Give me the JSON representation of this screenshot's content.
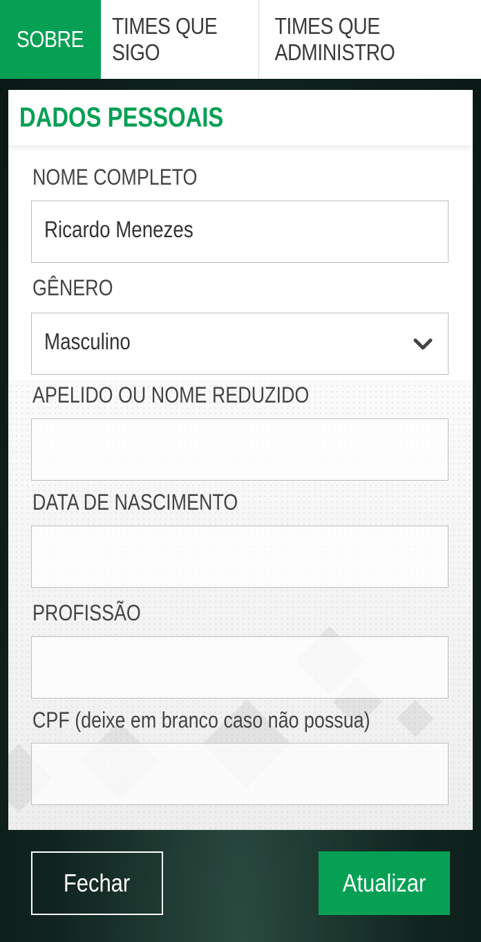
{
  "tabs": [
    {
      "label": "SOBRE",
      "active": true
    },
    {
      "label": "TIMES QUE SIGO",
      "active": false
    },
    {
      "label": "TIMES QUE ADMINISTRO",
      "active": false
    }
  ],
  "section": {
    "title": "DADOS PESSOAIS"
  },
  "fields": {
    "full_name": {
      "label": "NOME COMPLETO",
      "value": "Ricardo Menezes"
    },
    "gender": {
      "label": "GÊNERO",
      "value": "Masculino"
    },
    "nickname": {
      "label": "APELIDO OU NOME REDUZIDO",
      "value": ""
    },
    "birth_date": {
      "label": "DATA DE NASCIMENTO",
      "value": ""
    },
    "profession": {
      "label": "PROFISSÃO",
      "value": ""
    },
    "cpf": {
      "label": "CPF (deixe em branco caso não possua)",
      "value": ""
    }
  },
  "buttons": {
    "close": "Fechar",
    "update": "Atualizar"
  },
  "colors": {
    "accent": "#06a054",
    "background": "#10241f"
  },
  "icons": {
    "gender_dropdown": "chevron-down-icon"
  }
}
